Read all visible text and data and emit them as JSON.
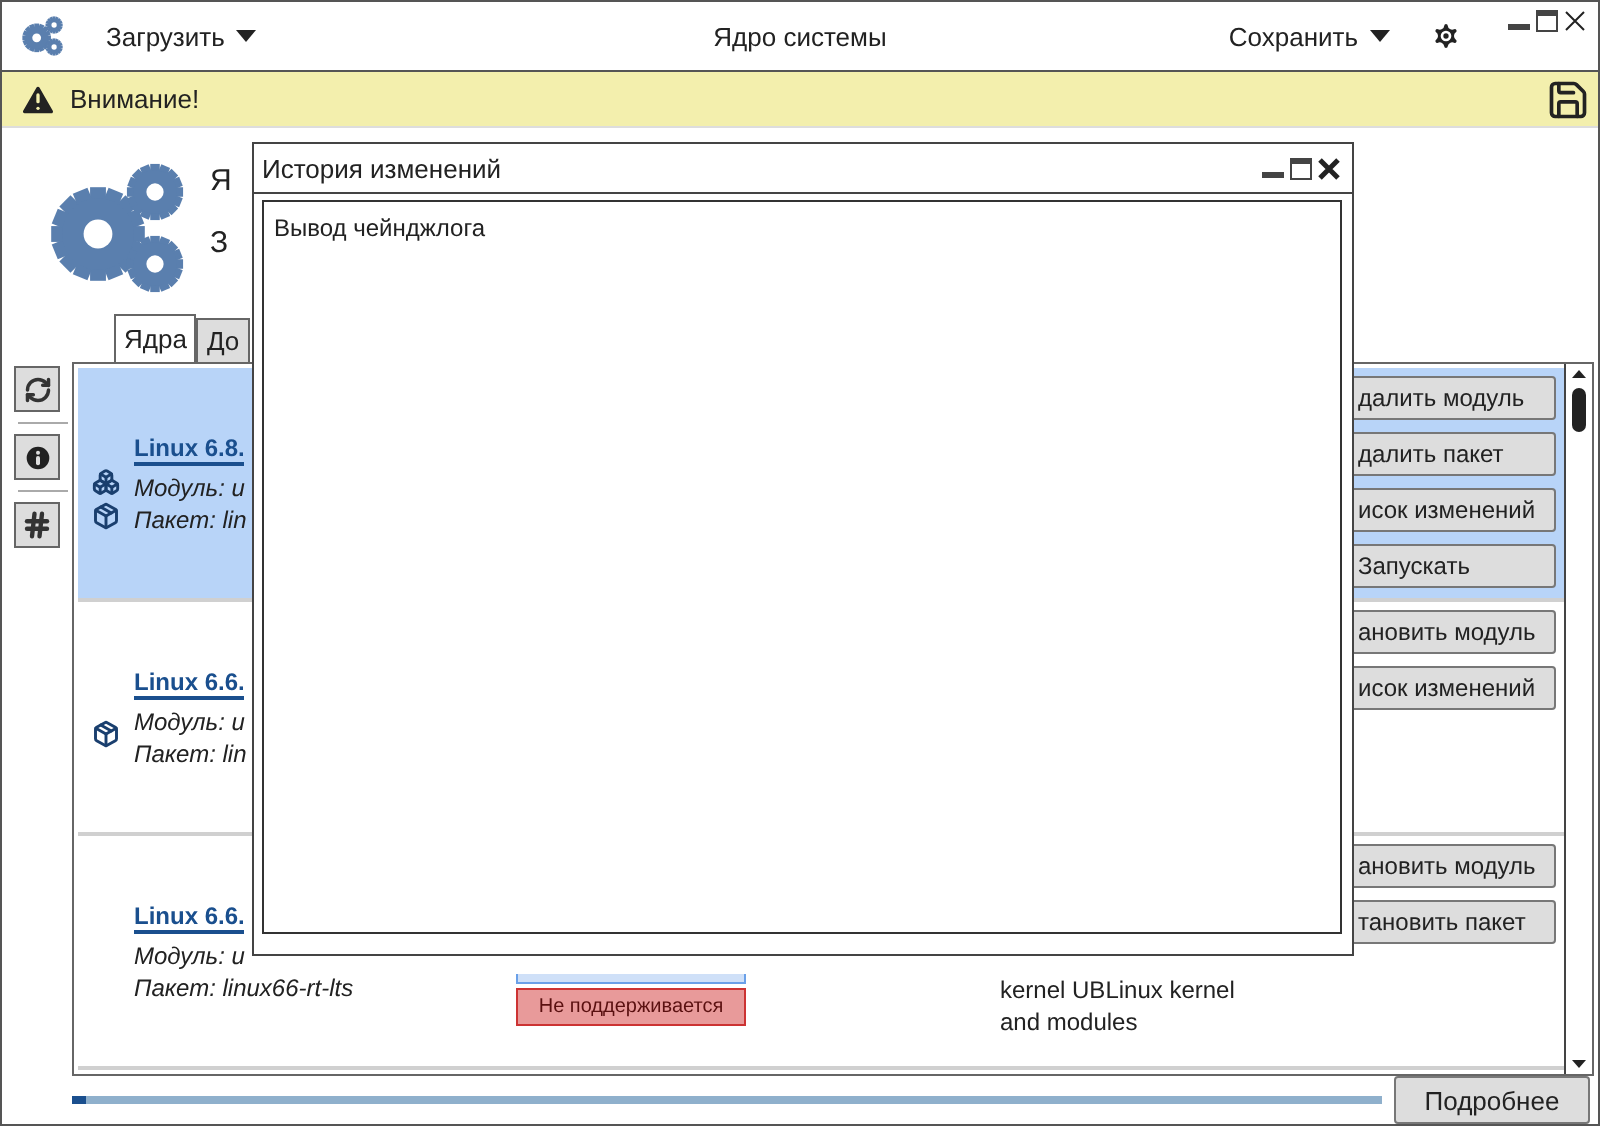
{
  "window": {
    "title": "Ядро системы",
    "load_menu": "Загрузить",
    "save_menu": "Сохранить"
  },
  "warning": {
    "text": "Внимание!"
  },
  "header": {
    "line_1": "Я",
    "line_2": "З"
  },
  "tabs": [
    {
      "label": "Ядра",
      "selected": true
    },
    {
      "label": "До",
      "selected": false
    }
  ],
  "kernels": [
    {
      "name": "Linux 6.8.",
      "module": "Модуль: u",
      "package": "Пакет: lin",
      "selected": true,
      "module_installed": true,
      "package_installed": true,
      "actions": [
        "далить модуль",
        "далить пакет",
        "исок изменений",
        "Запускать"
      ]
    },
    {
      "name": "Linux 6.6.",
      "module": "Модуль: u",
      "package": "Пакет: lin",
      "selected": false,
      "module_installed": false,
      "package_installed": true,
      "actions": [
        "ановить модуль",
        "исок изменений"
      ]
    },
    {
      "name": "Linux 6.6.",
      "module": "Модуль: u",
      "package": "Пакет: linux66-rt-lts",
      "selected": false,
      "module_installed": false,
      "package_installed": false,
      "status": "Не поддерживается",
      "description": "kernel UBLinux kernel and modules",
      "actions": [
        "ановить модуль",
        "тановить пакет"
      ]
    }
  ],
  "progress": {
    "level": 0.01
  },
  "details_button": "Подробнее",
  "dialog": {
    "title": "История изменений",
    "content": "Вывод чейнджлога"
  }
}
